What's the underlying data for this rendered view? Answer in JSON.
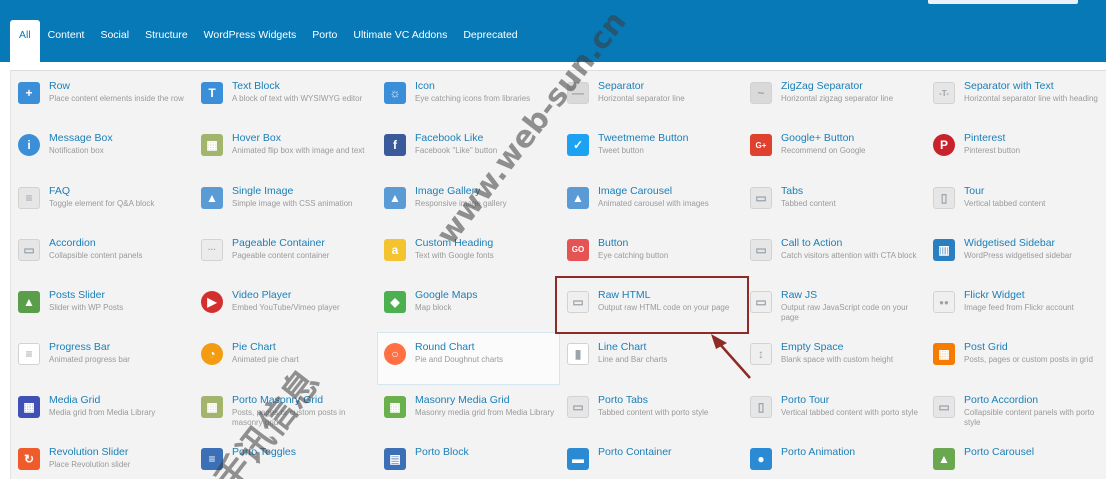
{
  "tabs": [
    {
      "label": "All",
      "active": true
    },
    {
      "label": "Content"
    },
    {
      "label": "Social"
    },
    {
      "label": "Structure"
    },
    {
      "label": "WordPress Widgets"
    },
    {
      "label": "Porto"
    },
    {
      "label": "Ultimate VC Addons"
    },
    {
      "label": "Deprecated"
    }
  ],
  "elements": [
    {
      "name": "row",
      "title": "Row",
      "desc": "Place content elements inside the row",
      "icon": "plus-icon",
      "color": "#3b8fd9",
      "glyph": "+"
    },
    {
      "name": "text-block",
      "title": "Text Block",
      "desc": "A block of text with WYSIWYG editor",
      "icon": "text-t-icon",
      "color": "#3b8fd9",
      "glyph": "T"
    },
    {
      "name": "icon",
      "title": "Icon",
      "desc": "Eye catching icons from libraries",
      "icon": "sun-icon",
      "color": "#3b8fd9",
      "glyph": "☼"
    },
    {
      "name": "separator",
      "title": "Separator",
      "desc": "Horizontal separator line",
      "icon": "separator-line-icon",
      "color": "#d9d9d9",
      "glyph": "—"
    },
    {
      "name": "zigzag-separator",
      "title": "ZigZag Separator",
      "desc": "Horizontal zigzag separator line",
      "icon": "zigzag-icon",
      "color": "#d9d9d9",
      "glyph": "~"
    },
    {
      "name": "separator-with-text",
      "title": "Separator with Text",
      "desc": "Horizontal separator line with heading",
      "icon": "separator-text-icon",
      "color": "#e6e6e6",
      "glyph": "-T-"
    },
    {
      "name": "message-box",
      "title": "Message Box",
      "desc": "Notification box",
      "icon": "info-icon",
      "color": "#3b8fd9",
      "glyph": "i",
      "round": true
    },
    {
      "name": "hover-box",
      "title": "Hover Box",
      "desc": "Animated flip box with image and text",
      "icon": "hover-box-image-icon",
      "color": "#a3b46c",
      "glyph": "▦"
    },
    {
      "name": "facebook-like",
      "title": "Facebook Like",
      "desc": "Facebook \"Like\" button",
      "icon": "facebook-icon",
      "color": "#3b5a9a",
      "glyph": "f"
    },
    {
      "name": "tweetmeme-button",
      "title": "Tweetmeme Button",
      "desc": "Tweet button",
      "icon": "twitter-icon",
      "color": "#1da1f2",
      "glyph": "✓"
    },
    {
      "name": "google-plus-button",
      "title": "Google+ Button",
      "desc": "Recommend on Google",
      "icon": "google-plus-icon",
      "color": "#e0412f",
      "glyph": "G+"
    },
    {
      "name": "pinterest",
      "title": "Pinterest",
      "desc": "Pinterest button",
      "icon": "pinterest-icon",
      "color": "#c8232c",
      "glyph": "P",
      "round": true
    },
    {
      "name": "faq",
      "title": "FAQ",
      "desc": "Toggle element for Q&A block",
      "icon": "faq-toggle-icon",
      "color": "#e6e6e6",
      "glyph": "≡"
    },
    {
      "name": "single-image",
      "title": "Single Image",
      "desc": "Simple image with CSS animation",
      "icon": "image-icon",
      "color": "#5b9bd5",
      "glyph": "▲"
    },
    {
      "name": "image-gallery",
      "title": "Image Gallery",
      "desc": "Responsive image gallery",
      "icon": "gallery-icon",
      "color": "#5b9bd5",
      "glyph": "▲"
    },
    {
      "name": "image-carousel",
      "title": "Image Carousel",
      "desc": "Animated carousel with images",
      "icon": "carousel-icon",
      "color": "#5b9bd5",
      "glyph": "▲"
    },
    {
      "name": "tabs",
      "title": "Tabs",
      "desc": "Tabbed content",
      "icon": "tabs-icon",
      "color": "#e6e6e6",
      "glyph": "▭"
    },
    {
      "name": "tour",
      "title": "Tour",
      "desc": "Vertical tabbed content",
      "icon": "tour-icon",
      "color": "#e6e6e6",
      "glyph": "▯"
    },
    {
      "name": "accordion",
      "title": "Accordion",
      "desc": "Collapsible content panels",
      "icon": "accordion-icon",
      "color": "#e6e6e6",
      "glyph": "▭"
    },
    {
      "name": "pageable-container",
      "title": "Pageable Container",
      "desc": "Pageable content container",
      "icon": "pageable-icon",
      "color": "#ececec",
      "glyph": "···"
    },
    {
      "name": "custom-heading",
      "title": "Custom Heading",
      "desc": "Text with Google fonts",
      "icon": "heading-a-icon",
      "color": "#f4c430",
      "glyph": "a"
    },
    {
      "name": "button",
      "title": "Button",
      "desc": "Eye catching button",
      "icon": "go-button-icon",
      "color": "#e55353",
      "glyph": "GO"
    },
    {
      "name": "call-to-action",
      "title": "Call to Action",
      "desc": "Catch visitors attention with CTA block",
      "icon": "cta-icon",
      "color": "#e6e6e6",
      "glyph": "▭"
    },
    {
      "name": "widgetised-sidebar",
      "title": "Widgetised Sidebar",
      "desc": "WordPress widgetised sidebar",
      "icon": "sidebar-icon",
      "color": "#2a7fc0",
      "glyph": "▥"
    },
    {
      "name": "posts-slider",
      "title": "Posts Slider",
      "desc": "Slider with WP Posts",
      "icon": "posts-slider-icon",
      "color": "#5a9e4b",
      "glyph": "▲"
    },
    {
      "name": "video-player",
      "title": "Video Player",
      "desc": "Embed YouTube/Vimeo player",
      "icon": "play-icon",
      "color": "#d32f2f",
      "glyph": "▶",
      "round": true
    },
    {
      "name": "google-maps",
      "title": "Google Maps",
      "desc": "Map block",
      "icon": "map-pin-icon",
      "color": "#4caf50",
      "glyph": "◆"
    },
    {
      "name": "raw-html",
      "title": "Raw HTML",
      "desc": "Output raw HTML code on your page",
      "icon": "html-file-icon",
      "color": "#efefef",
      "glyph": "▭"
    },
    {
      "name": "raw-js",
      "title": "Raw JS",
      "desc": "Output raw JavaScript code on your page",
      "icon": "js-file-icon",
      "color": "#efefef",
      "glyph": "▭"
    },
    {
      "name": "flickr-widget",
      "title": "Flickr Widget",
      "desc": "Image feed from Flickr account",
      "icon": "flickr-icon",
      "color": "#efefef",
      "glyph": "●●"
    },
    {
      "name": "progress-bar",
      "title": "Progress Bar",
      "desc": "Animated progress bar",
      "icon": "progress-bars-icon",
      "color": "#ffffff",
      "glyph": "≡"
    },
    {
      "name": "pie-chart",
      "title": "Pie Chart",
      "desc": "Animated pie chart",
      "icon": "pie-chart-icon",
      "color": "#f39c12",
      "glyph": "◔",
      "round": true
    },
    {
      "name": "round-chart",
      "title": "Round Chart",
      "desc": "Pie and Doughnut charts",
      "icon": "round-chart-icon",
      "color": "#ff7043",
      "glyph": "○",
      "round": true
    },
    {
      "name": "line-chart",
      "title": "Line Chart",
      "desc": "Line and Bar charts",
      "icon": "bar-chart-icon",
      "color": "#ffffff",
      "glyph": "▮"
    },
    {
      "name": "empty-space",
      "title": "Empty Space",
      "desc": "Blank space with custom height",
      "icon": "empty-space-icon",
      "color": "#efefef",
      "glyph": "↕"
    },
    {
      "name": "post-grid",
      "title": "Post Grid",
      "desc": "Posts, pages or custom posts in grid",
      "icon": "post-grid-icon",
      "color": "#f57c00",
      "glyph": "▦"
    },
    {
      "name": "media-grid",
      "title": "Media Grid",
      "desc": "Media grid from Media Library",
      "icon": "media-grid-icon",
      "color": "#3f51b5",
      "glyph": "▦"
    },
    {
      "name": "porto-masonry-grid",
      "title": "Porto Masonry Grid",
      "desc": "Posts, pages or custom posts in masonry grid",
      "icon": "masonry-grid-icon",
      "color": "#a3b46c",
      "glyph": "▦"
    },
    {
      "name": "masonry-media-grid",
      "title": "Masonry Media Grid",
      "desc": "Masonry media grid from Media Library",
      "icon": "masonry-media-icon",
      "color": "#6ab04c",
      "glyph": "▦"
    },
    {
      "name": "porto-tabs",
      "title": "Porto Tabs",
      "desc": "Tabbed content with porto style",
      "icon": "porto-tabs-icon",
      "color": "#e6e6e6",
      "glyph": "▭"
    },
    {
      "name": "porto-tour",
      "title": "Porto Tour",
      "desc": "Vertical tabbed content with porto style",
      "icon": "porto-tour-icon",
      "color": "#e6e6e6",
      "glyph": "▯"
    },
    {
      "name": "porto-accordion",
      "title": "Porto Accordion",
      "desc": "Collapsible content panels with porto style",
      "icon": "porto-accordion-icon",
      "color": "#e6e6e6",
      "glyph": "▭"
    },
    {
      "name": "revolution-slider",
      "title": "Revolution Slider",
      "desc": "Place Revolution slider",
      "icon": "revolution-icon",
      "color": "#ef5b2b",
      "glyph": "↻"
    },
    {
      "name": "porto-toggles",
      "title": "Porto Toggles",
      "desc": "",
      "icon": "porto-toggles-icon",
      "color": "#3b6fb6",
      "glyph": "≡"
    },
    {
      "name": "porto-block",
      "title": "Porto Block",
      "desc": "",
      "icon": "porto-block-icon",
      "color": "#3b6fb6",
      "glyph": "▤"
    },
    {
      "name": "porto-container",
      "title": "Porto Container",
      "desc": "",
      "icon": "porto-container-icon",
      "color": "#2a8bd4",
      "glyph": "▬"
    },
    {
      "name": "porto-animation",
      "title": "Porto Animation",
      "desc": "",
      "icon": "porto-animation-icon",
      "color": "#2a8bd4",
      "glyph": "●"
    },
    {
      "name": "porto-carousel",
      "title": "Porto Carousel",
      "desc": "",
      "icon": "porto-carousel-icon",
      "color": "#6aa84f",
      "glyph": "▲"
    }
  ],
  "watermark": [
    "www.web-sun.cn",
    "手讯信息"
  ]
}
